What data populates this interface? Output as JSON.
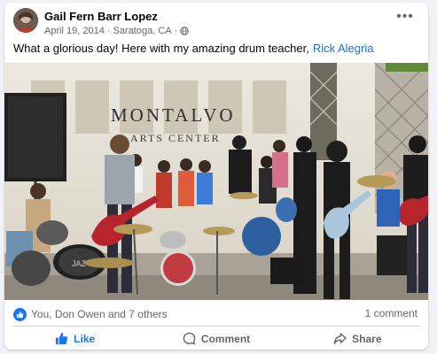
{
  "post": {
    "author": "Gail Fern Barr Lopez",
    "date": "April 19, 2014",
    "separator": "·",
    "location": "Saratoga, CA",
    "separator2": "·",
    "privacy_icon": "globe-icon",
    "text": "What a glorious day! Here with my amazing drum teacher,",
    "mention": "Rick Alegria"
  },
  "photo": {
    "sign_line1": "MONTALVO",
    "sign_line2": "ARTS CENTER"
  },
  "reactions": {
    "summary": "You, Don Owen and 7 others",
    "comment_count": "1 comment",
    "icon": "thumbs-up-icon"
  },
  "actions": {
    "like": "Like",
    "comment": "Comment",
    "share": "Share"
  },
  "colors": {
    "accent": "#1877f2",
    "mention": "#216fdb",
    "secondary_text": "#65676b"
  }
}
